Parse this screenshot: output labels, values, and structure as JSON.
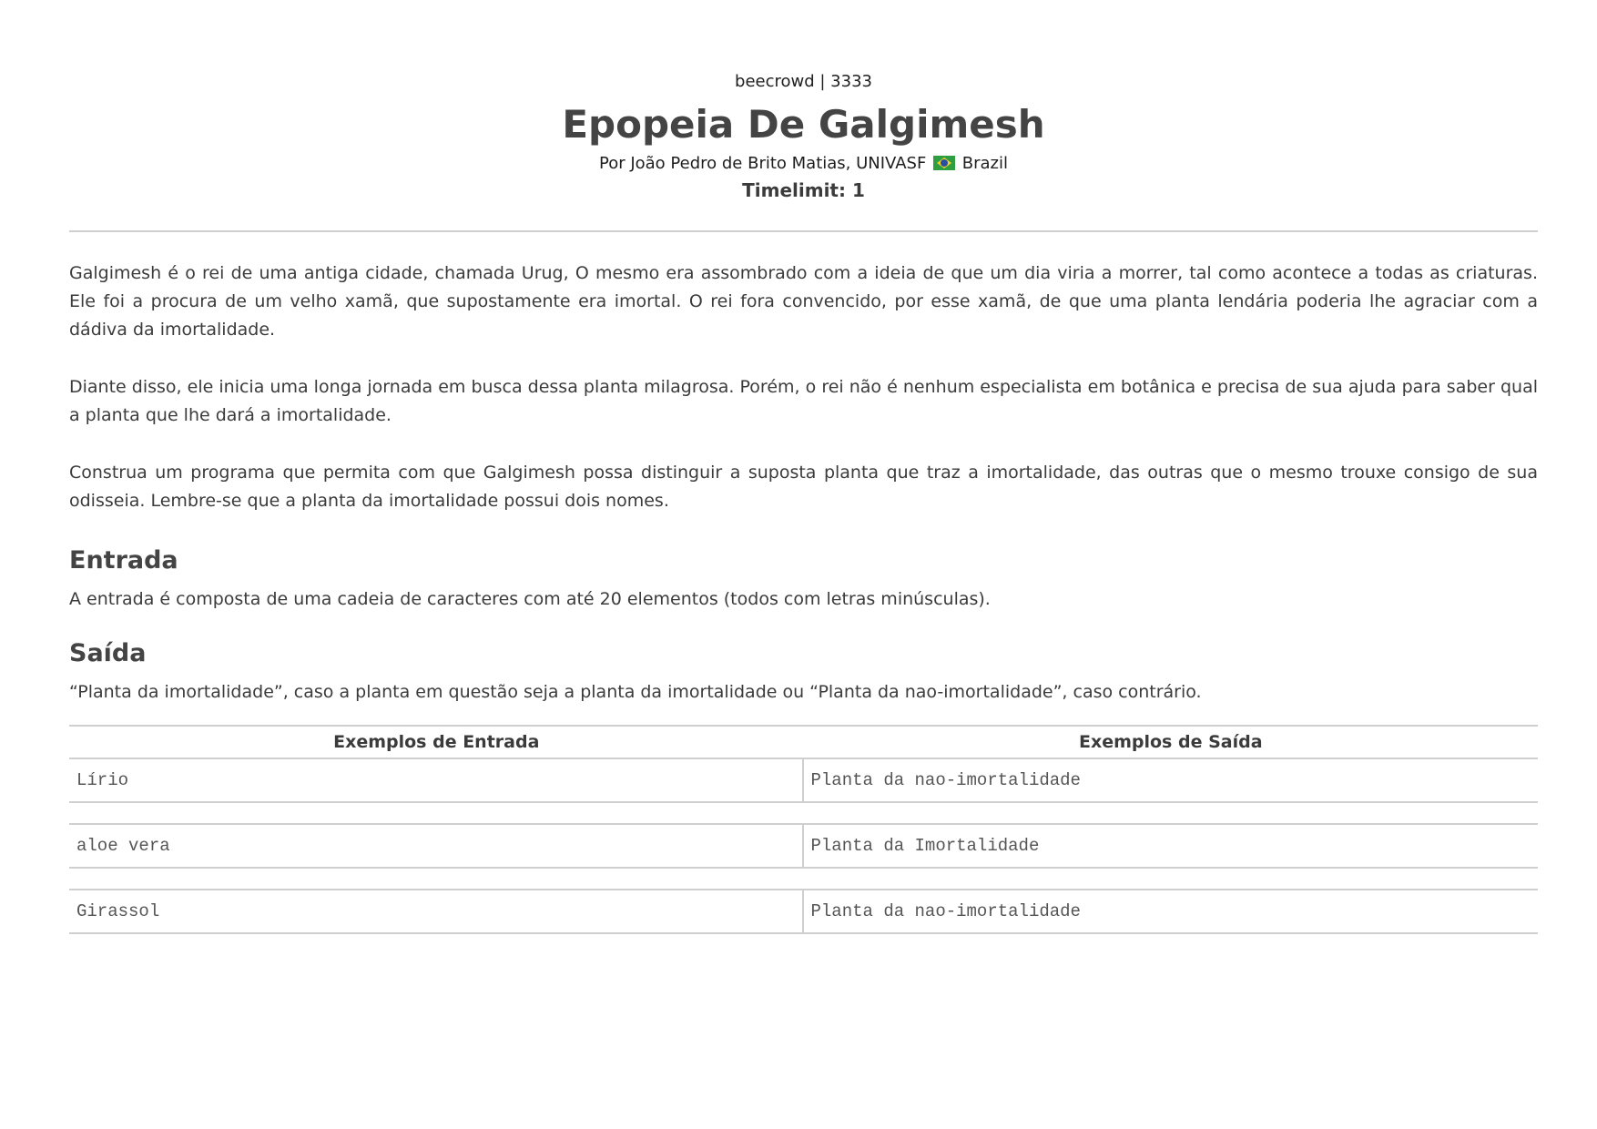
{
  "header": {
    "site": "beecrowd | 3333",
    "title": "Epopeia De Galgimesh",
    "author_prefix": "Por João Pedro de Brito Matias, UNIVASF",
    "country": "Brazil",
    "flag_icon": "brazil-flag-icon",
    "timelimit": "Timelimit: 1"
  },
  "description": [
    "Galgimesh é o rei de uma antiga cidade, chamada Urug, O mesmo era assombrado com a ideia de que um dia viria a morrer, tal como acontece a todas as criaturas. Ele foi a procura de um velho xamã, que supostamente era imortal. O rei fora convencido, por esse xamã, de que uma planta lendária poderia lhe agraciar com a dádiva da imortalidade.",
    "Diante disso, ele inicia uma longa jornada em busca dessa planta milagrosa. Porém, o rei não é nenhum especialista em botânica e precisa de sua ajuda para saber qual a planta que lhe dará a imortalidade.",
    "Construa um programa que permita com que Galgimesh possa distinguir a suposta planta que traz a imortalidade, das outras que o mesmo trouxe consigo de sua odisseia. Lembre-se que a planta da imortalidade possui dois nomes."
  ],
  "input": {
    "heading": "Entrada",
    "text": "A entrada é composta de uma cadeia de caracteres com até 20 elementos (todos com letras minúsculas)."
  },
  "output": {
    "heading": "Saída",
    "text": "“Planta da imortalidade”, caso a planta em questão seja a planta da imortalidade ou “Planta da nao-imortalidade”, caso contrário."
  },
  "examples": {
    "input_header": "Exemplos de Entrada",
    "output_header": "Exemplos de Saída",
    "rows": [
      {
        "input": "Lírio",
        "output": "Planta da nao-imortalidade"
      },
      {
        "input": "aloe vera",
        "output": "Planta da Imortalidade"
      },
      {
        "input": "Girassol",
        "output": "Planta da nao-imortalidade"
      }
    ]
  }
}
